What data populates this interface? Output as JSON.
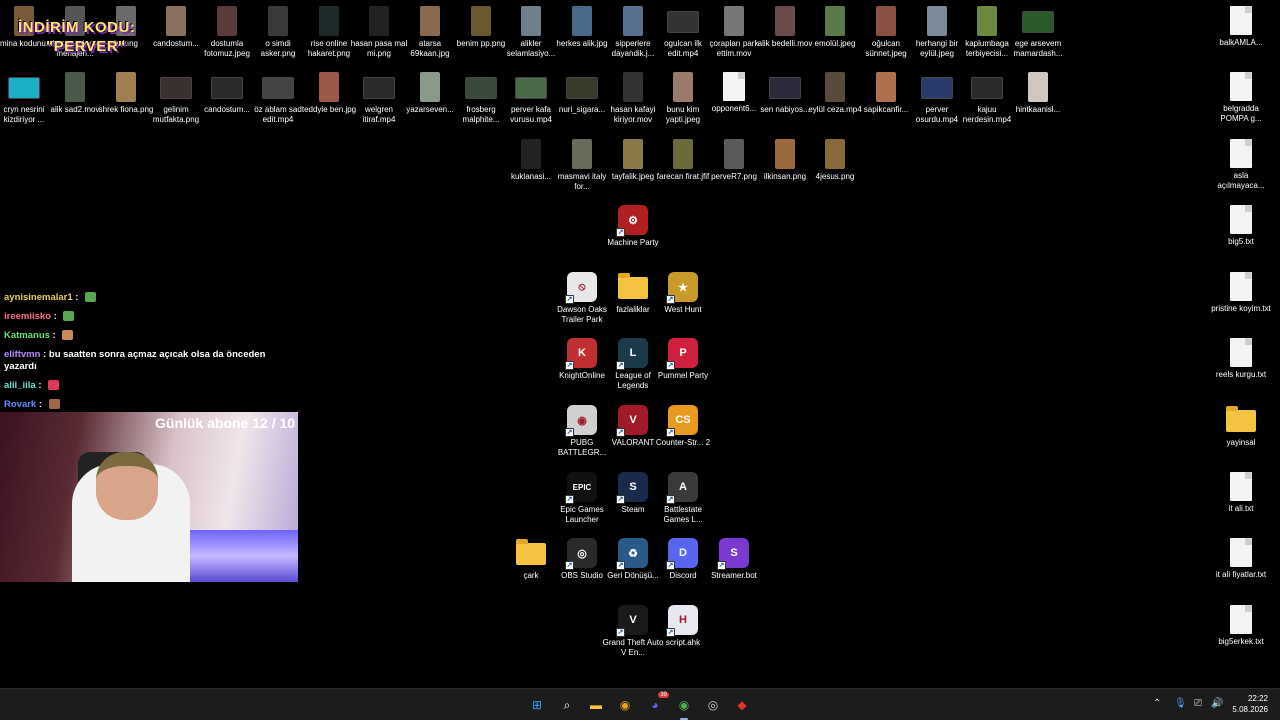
{
  "promo": {
    "line1": "İNDİRİM KODU:",
    "line2": "\"PERVER\""
  },
  "subs": "Günlük abone 12 / 10",
  "chat": [
    {
      "user": "aynisinemalar1",
      "color": "#e8d44a",
      "text": "",
      "emote": "#58a84f"
    },
    {
      "user": "ireemiisko",
      "color": "#ff6b8a",
      "text": "",
      "emote": "#58a84f"
    },
    {
      "user": "Katmanus",
      "color": "#6be37a",
      "text": "",
      "emote": "#c98b5a"
    },
    {
      "user": "eliftvmn",
      "color": "#b98cff",
      "text": "bu saatten sonra açmaz açıcak olsa da önceden yazardı",
      "emote": ""
    },
    {
      "user": "alii_iila",
      "color": "#6be3d6",
      "text": "",
      "emote": "#e03a5a"
    },
    {
      "user": "Rovark",
      "color": "#6b8cff",
      "text": "",
      "emote": "#a06a4a"
    }
  ],
  "desktop_icons": [
    {
      "label": "amina kodunu...",
      "kind": "photo",
      "color": "#7a5a3a"
    },
    {
      "label": "fotomuz.jpeg menajeri...",
      "kind": "photo",
      "color": "#555"
    },
    {
      "label": "bakıng",
      "kind": "photo",
      "color": "#6a6a6a"
    },
    {
      "label": "candostum...",
      "kind": "photo",
      "color": "#8a7060"
    },
    {
      "label": "dostumla fotomuz.jpeg",
      "kind": "photo",
      "color": "#5a3a3a"
    },
    {
      "label": "o simdi asker.png",
      "kind": "photo",
      "color": "#3a3a3a"
    },
    {
      "label": "rise online hakaret.png",
      "kind": "photo",
      "color": "#1e2a2a"
    },
    {
      "label": "hasan pasa mal mi.png",
      "kind": "photo",
      "color": "#222"
    },
    {
      "label": "atarsa 69kaan.jpg",
      "kind": "photo",
      "color": "#8a6a50"
    },
    {
      "label": "benim pp.png",
      "kind": "photo",
      "color": "#6a5a30"
    },
    {
      "label": "alikler selamlasiyo...",
      "kind": "photo",
      "color": "#70808a"
    },
    {
      "label": "herkes alik.jpg",
      "kind": "photo",
      "color": "#4a6a8a"
    },
    {
      "label": "sipperlere dayandik.j...",
      "kind": "photo",
      "color": "#5a7090"
    },
    {
      "label": "ogulcan ilk edit.mp4",
      "kind": "video",
      "color": "#333"
    },
    {
      "label": "çorapları park ettim.mov",
      "kind": "photo",
      "color": "#777"
    },
    {
      "label": "alik bedelli.mov",
      "kind": "photo",
      "color": "#6a4a4a"
    },
    {
      "label": "emolül.jpeg",
      "kind": "photo",
      "color": "#5a7a4a"
    },
    {
      "label": "oğulcan sünnet.jpeg",
      "kind": "photo",
      "color": "#8a5040"
    },
    {
      "label": "herhangi bir eylül.jpeg",
      "kind": "photo",
      "color": "#7a8a9a"
    },
    {
      "label": "kaplumbaga terbiyecisi...",
      "kind": "photo",
      "color": "#6a8a40"
    },
    {
      "label": "ege arsevem mamardash...",
      "kind": "video",
      "color": "#2a5a2a"
    },
    {
      "label": "cryn nesrini kizdiriyor ...",
      "kind": "video",
      "color": "#1ab0c8"
    },
    {
      "label": "alik sad2.mov",
      "kind": "photo",
      "color": "#4a5a4a"
    },
    {
      "label": "shrek fiona.png",
      "kind": "photo",
      "color": "#a08050"
    },
    {
      "label": "gelinim mutfakta.png",
      "kind": "video",
      "color": "#3a3030"
    },
    {
      "label": "candostum...",
      "kind": "video",
      "color": "#2a2a2a"
    },
    {
      "label": "öz ablam sad edit.mp4",
      "kind": "video",
      "color": "#444"
    },
    {
      "label": "teddyle ben.jpg",
      "kind": "photo",
      "color": "#9a5a4a"
    },
    {
      "label": "welgren itiraf.mp4",
      "kind": "video",
      "color": "#2a2a2a"
    },
    {
      "label": "yazarseven...",
      "kind": "photo",
      "color": "#8a9a8a"
    },
    {
      "label": "frosberg malphite...",
      "kind": "video",
      "color": "#3a4a3a"
    },
    {
      "label": "perver kafa vurusu.mp4",
      "kind": "video",
      "color": "#4a6a4a"
    },
    {
      "label": "nuri_sigara...",
      "kind": "video",
      "color": "#3a3a2a"
    },
    {
      "label": "hasan kafayi kiriyor.mov",
      "kind": "photo",
      "color": "#333"
    },
    {
      "label": "bunu kim yapti.jpeg",
      "kind": "photo",
      "color": "#9a7a6a"
    },
    {
      "label": "opponent6...",
      "kind": "doc",
      "color": "#f3f3f3"
    },
    {
      "label": "sen nabiyos...",
      "kind": "video",
      "color": "#2a2a3a"
    },
    {
      "label": "eylül ceza.mp4",
      "kind": "photo",
      "color": "#5a4a3a"
    },
    {
      "label": "sapikcanfir...",
      "kind": "photo",
      "color": "#b07050"
    },
    {
      "label": "perver osurdu.mp4",
      "kind": "video",
      "color": "#2a3a6a"
    },
    {
      "label": "kajuu nerdesin.mp4",
      "kind": "video",
      "color": "#2a2a2a"
    },
    {
      "label": "hintkaanisl...",
      "kind": "photo",
      "color": "#d0c8c0"
    },
    {
      "label": "kuklanasi...",
      "kind": "photo",
      "color": "#222"
    },
    {
      "label": "masmavi italy for...",
      "kind": "photo",
      "color": "#6a6a5a"
    },
    {
      "label": "tayfalik.jpeg",
      "kind": "photo",
      "color": "#8a7a4a"
    },
    {
      "label": "farecan firat.jfif",
      "kind": "photo",
      "color": "#6a6a3a"
    },
    {
      "label": "perveR7.png",
      "kind": "photo",
      "color": "#5a5a5a"
    },
    {
      "label": "ilkinsan.png",
      "kind": "photo",
      "color": "#9a6a3a"
    },
    {
      "label": "4jesus.png",
      "kind": "photo",
      "color": "#8a6a3a"
    },
    {
      "label": "Machine Party",
      "kind": "app",
      "color": "#b02020",
      "glyph": "⚙"
    },
    {
      "label": "Dawson Oaks Trailer Park",
      "kind": "app",
      "color": "#e8e8e8",
      "glyph": "⦸"
    },
    {
      "label": "fazlaliklar",
      "kind": "folder",
      "color": "#f5c242"
    },
    {
      "label": "West Hunt",
      "kind": "app",
      "color": "#c89a2a",
      "glyph": "★"
    },
    {
      "label": "KnightOnline",
      "kind": "app",
      "color": "#c03030",
      "glyph": "K"
    },
    {
      "label": "League of Legends",
      "kind": "app",
      "color": "#1a3a4a",
      "glyph": "L"
    },
    {
      "label": "Pummel Party",
      "kind": "app",
      "color": "#d02040",
      "glyph": "P"
    },
    {
      "label": "PUBG BATTLEGR...",
      "kind": "app",
      "color": "#d0d0d0",
      "glyph": "◉"
    },
    {
      "label": "VALORANT",
      "kind": "app",
      "color": "#a01a2a",
      "glyph": "V"
    },
    {
      "label": "Counter-Str... 2",
      "kind": "app",
      "color": "#e89a20",
      "glyph": "CS"
    },
    {
      "label": "Epic Games Launcher",
      "kind": "app",
      "color": "#111",
      "glyph": "EPIC"
    },
    {
      "label": "Steam",
      "kind": "app",
      "color": "#1a2a4a",
      "glyph": "S"
    },
    {
      "label": "Battlestate Games L...",
      "kind": "app",
      "color": "#3a3a3a",
      "glyph": "A"
    },
    {
      "label": "çark",
      "kind": "folder",
      "color": "#f5c242"
    },
    {
      "label": "OBS Studio",
      "kind": "app",
      "color": "#2a2a2a",
      "glyph": "◎"
    },
    {
      "label": "Geri Dönüşü...",
      "kind": "app",
      "color": "#2a5a8a",
      "glyph": "♻"
    },
    {
      "label": "Discord",
      "kind": "app",
      "color": "#5865f2",
      "glyph": "D"
    },
    {
      "label": "Streamer.bot",
      "kind": "app",
      "color": "#7a3ad0",
      "glyph": "S"
    },
    {
      "label": "Grand Theft Auto V En...",
      "kind": "app",
      "color": "#1a1a1a",
      "glyph": "V"
    },
    {
      "label": "script.ahk",
      "kind": "app",
      "color": "#e8e8f0",
      "glyph": "H"
    },
    {
      "label": "balkAMLA...",
      "kind": "doc",
      "color": "#f3f3f3"
    },
    {
      "label": "belgradda POMPA g...",
      "kind": "doc",
      "color": "#f3f3f3"
    },
    {
      "label": "asla açılmayaca...",
      "kind": "doc",
      "color": "#f3f3f3"
    },
    {
      "label": "big5.txt",
      "kind": "doc",
      "color": "#f3f3f3"
    },
    {
      "label": "pristine koyim.txt",
      "kind": "doc",
      "color": "#f3f3f3"
    },
    {
      "label": "reels kurgu.txt",
      "kind": "doc",
      "color": "#f3f3f3"
    },
    {
      "label": "yayinsal",
      "kind": "folder",
      "color": "#f5c242"
    },
    {
      "label": "it ali.txt",
      "kind": "doc",
      "color": "#f3f3f3"
    },
    {
      "label": "it ali fiyatlar.txt",
      "kind": "doc",
      "color": "#f3f3f3"
    },
    {
      "label": "big5erkek.txt",
      "kind": "doc",
      "color": "#f3f3f3"
    }
  ],
  "taskbar": {
    "apps": [
      {
        "name": "start-icon",
        "glyph": "⊞",
        "color": "#3aa0ff"
      },
      {
        "name": "search-icon",
        "glyph": "⌕",
        "color": "#ffffff"
      },
      {
        "name": "file-explorer-icon",
        "glyph": "▬",
        "color": "#f5c242"
      },
      {
        "name": "chrome-icon",
        "glyph": "◉",
        "color": "#e8a020"
      },
      {
        "name": "discord-icon",
        "glyph": "◕",
        "color": "#5865f2",
        "badge": "39"
      },
      {
        "name": "chrome-active-icon",
        "glyph": "◉",
        "color": "#4caf50",
        "active": true
      },
      {
        "name": "obs-icon",
        "glyph": "◎",
        "color": "#cccccc"
      },
      {
        "name": "app-red-icon",
        "glyph": "◆",
        "color": "#e03030"
      }
    ],
    "time": "22:22",
    "date": "5.08.2026"
  }
}
